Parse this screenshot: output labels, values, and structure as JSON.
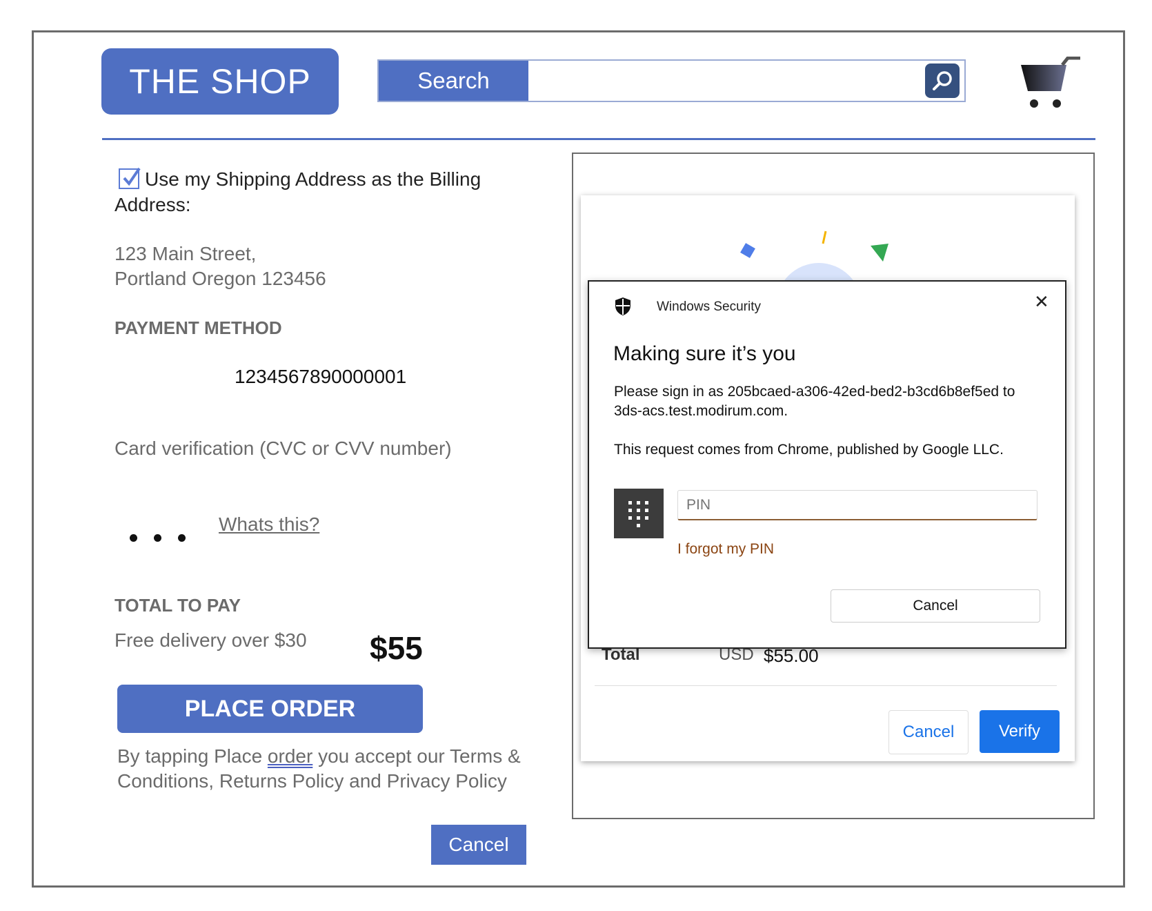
{
  "header": {
    "logo_text": "THE SHOP",
    "search_label": "Search",
    "search_placeholder": "",
    "search_icon": "search-icon",
    "cart_icon": "cart-icon"
  },
  "billing": {
    "checkbox_checked": true,
    "use_shipping_label_line1": "Use my Shipping Address as the Billing",
    "use_shipping_label_line2": "Address:",
    "address_line1": "123 Main Street,",
    "address_line2": "Portland Oregon 123456"
  },
  "payment": {
    "heading": "PAYMENT METHOD",
    "card_number": "1234567890000001",
    "cvc_label": "Card verification (CVC or CVV number)",
    "whats_this": "Whats this?"
  },
  "total": {
    "heading": "TOTAL TO PAY",
    "delivery_note": "Free delivery over $30",
    "amount": "$55",
    "place_order": "PLACE ORDER",
    "terms_before": "By tapping Place ",
    "terms_link": "order",
    "terms_after": " you accept our Terms & Conditions, Returns Policy and Privacy Policy",
    "cancel": "Cancel"
  },
  "payment_sheet": {
    "total_label": "Total",
    "currency": "USD",
    "total_amount": "$55.00",
    "cancel": "Cancel",
    "verify": "Verify",
    "accent": "#1a73e8"
  },
  "windows_security": {
    "title": "Windows Security",
    "heading": "Making sure it’s you",
    "message": "Please sign in as 205bcaed-a306-42ed-bed2-b3cd6b8ef5ed to 3ds-acs.test.modirum.com.",
    "source": "This request comes from Chrome, published by Google LLC.",
    "pin_placeholder": "PIN",
    "forgot_pin": "I forgot my PIN",
    "cancel": "Cancel",
    "close_icon": "close-icon",
    "shield_icon": "shield-icon",
    "keypad_icon": "keypad-icon"
  },
  "colors": {
    "brand": "#4f6fc2",
    "link_brown": "#8b4513"
  }
}
